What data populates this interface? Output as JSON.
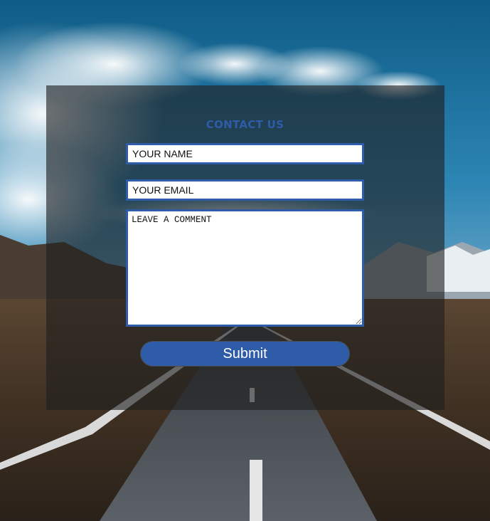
{
  "contact_form": {
    "title": "CONTACT US",
    "name_placeholder": "YOUR NAME",
    "email_placeholder": "YOUR EMAIL",
    "comment_placeholder": "LEAVE A COMMENT",
    "submit_label": "Submit"
  },
  "colors": {
    "accent": "#2f5ca8",
    "overlay": "#1e1e1e",
    "field_background": "#ffffff"
  },
  "background": {
    "icon": "mountain-road-landscape"
  }
}
